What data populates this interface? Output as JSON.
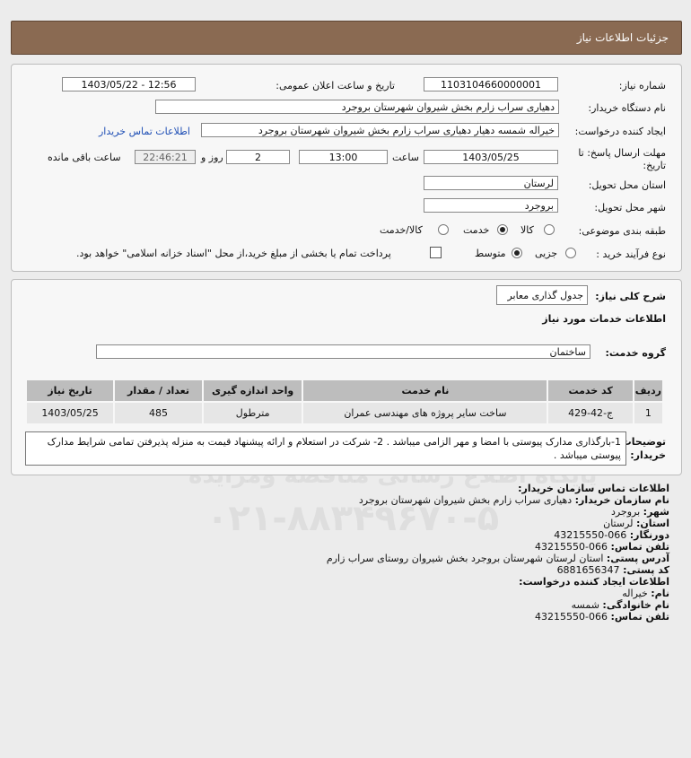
{
  "header": {
    "title": "جزئیات اطلاعات نیاز"
  },
  "form": {
    "need_number_label": "شماره نیاز:",
    "need_number": "1103104660000001",
    "announce_label": "تاریخ و ساعت اعلان عمومی:",
    "announce_value": "1403/05/22 - 12:56",
    "buyer_org_label": "نام دستگاه خریدار:",
    "buyer_org": "دهیاری سراب زارم بخش شیروان شهرستان بروجرد",
    "creator_label": "ایجاد کننده درخواست:",
    "creator": "خیراله شمسه دهیار دهیاری سراب زارم بخش شیروان شهرستان بروجرد",
    "contact_link": "اطلاعات تماس خریدار",
    "deadline_label_line1": "مهلت ارسال پاسخ: تا",
    "deadline_label_line2": "تاریخ:",
    "deadline_date": "1403/05/25",
    "time_label": "ساعت",
    "deadline_time": "13:00",
    "days_value": "2",
    "days_label": "روز و",
    "remaining_time": "22:46:21",
    "remaining_label": "ساعت باقی مانده",
    "province_label": "استان محل تحویل:",
    "province": "لرستان",
    "city_label": "شهر محل تحویل:",
    "city": "بروجرد",
    "category_label": "طبقه بندی موضوعی:",
    "category_options": [
      "کالا",
      "خدمت",
      "کالا/خدمت"
    ],
    "process_label": "نوع فرآیند خرید :",
    "process_options": [
      "جزیی",
      "متوسط"
    ],
    "payment_note": "پرداخت تمام یا بخشی از مبلغ خرید،از محل \"اسناد خزانه اسلامی\" خواهد بود."
  },
  "summary": {
    "label": "شرح کلی نیاز:",
    "value": "جدول گذاری معابر",
    "services_title": "اطلاعات خدمات مورد نیاز",
    "group_label": "گروه خدمت:",
    "group_value": "ساختمان"
  },
  "table": {
    "headers": [
      "ردیف",
      "کد خدمت",
      "نام خدمت",
      "واحد اندازه گیری",
      "تعداد / مقدار",
      "تاریخ نیاز"
    ],
    "rows": [
      [
        "1",
        "ج-42-429",
        "ساخت سایر پروژه های مهندسی عمران",
        "مترطول",
        "485",
        "1403/05/25"
      ]
    ]
  },
  "notes": {
    "label_line1": "توضیحات",
    "label_line2": "خریدار:",
    "text": "1-بارگذاری مدارک پیوستی با امضا و مهر الزامی میباشد . 2- شرکت در استعلام و ارائه پیشنهاد قیمت به منزله پذیرفتن تمامی شرایط مدارک پیوستی میباشد ."
  },
  "contact": {
    "title": "اطلاعات تماس سازمان خریدار:",
    "org_label": "نام سازمان خریدار:",
    "org": "دهیاری سراب زارم بخش شیروان شهرستان بروجرد",
    "city_label": "شهر:",
    "city": "بروجرد",
    "province_label": "استان:",
    "province": "لرستان",
    "fax_label": "دورنگار:",
    "fax": "066-43215550",
    "phone_label": "تلفن تماس:",
    "phone": "066-43215550",
    "address_label": "آدرس پستی:",
    "address": "استان لرستان شهرستان بروجرد بخش شیروان روستای سراب زارم",
    "postal_label": "کد پستی:",
    "postal": "6881656347",
    "creator_title": "اطلاعات ایجاد کننده درخواست:",
    "first_label": "نام:",
    "first": "خیراله",
    "last_label": "نام خانوادگی:",
    "last": "شمسه",
    "cphone_label": "تلفن تماس:",
    "cphone": "066-43215550"
  },
  "watermark": {
    "brand": "ParsNamadData",
    "line1": "پایگاه اطلاع رسانی مناقصه ومزایده",
    "phone": "۰۲۱-۸۸۳۴۹۶۷۰-۵"
  }
}
